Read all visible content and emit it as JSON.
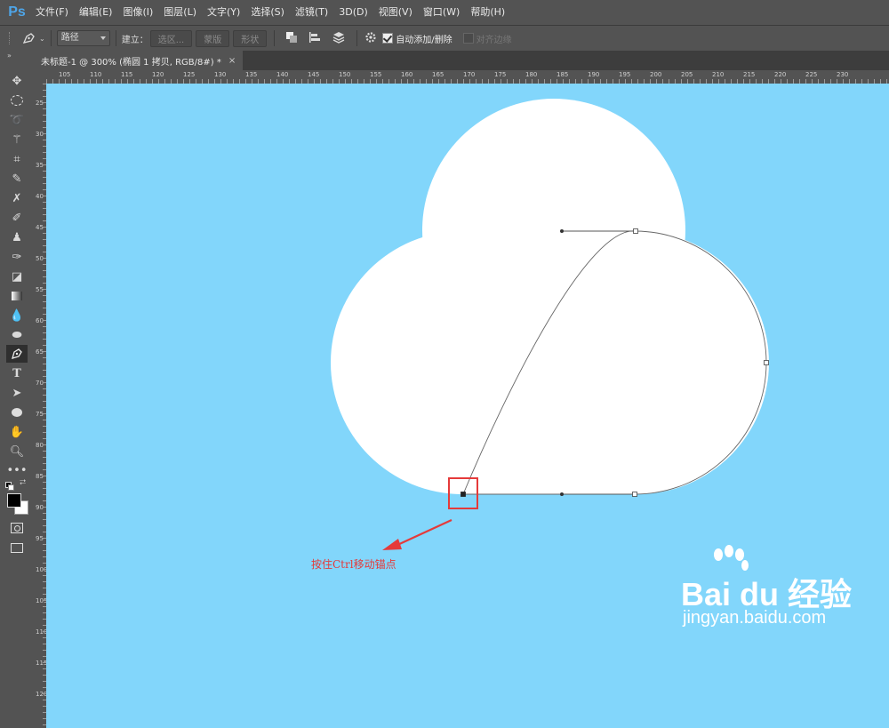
{
  "app": {
    "logo": "Ps",
    "menu": [
      "文件(F)",
      "编辑(E)",
      "图像(I)",
      "图层(L)",
      "文字(Y)",
      "选择(S)",
      "滤镜(T)",
      "3D(D)",
      "视图(V)",
      "窗口(W)",
      "帮助(H)"
    ]
  },
  "options": {
    "tool_icon": "pen-icon",
    "mode_select": "路径",
    "make_label": "建立：",
    "selection_btn": "选区...",
    "mask_btn": "蒙版",
    "shape_btn": "形状",
    "auto_add_delete_label": "自动添加/删除",
    "auto_add_delete_checked": true,
    "align_edges_label": "对齐边缘",
    "align_edges_checked": false
  },
  "document": {
    "tab_title": "未标题-1 @ 300% (椭圆 1 拷贝, RGB/8#) *",
    "tab_close": "×"
  },
  "rulers": {
    "top_labels": [
      "105",
      "110",
      "115",
      "120",
      "125",
      "130",
      "135",
      "140",
      "145",
      "150",
      "155",
      "160",
      "165",
      "170",
      "175",
      "180",
      "185",
      "190",
      "195",
      "200",
      "205",
      "210",
      "215",
      "220",
      "225",
      "230"
    ],
    "left_labels": [
      "25",
      "30",
      "35",
      "40",
      "45",
      "50",
      "55",
      "60",
      "65",
      "70",
      "75",
      "80",
      "85",
      "90",
      "95",
      "100",
      "105",
      "110",
      "115",
      "120"
    ]
  },
  "canvas": {
    "background": "#82d6fb",
    "shape_color": "#ffffff",
    "highlight_color": "#e53a3a",
    "tip_text": "按住Ctrl移动锚点"
  },
  "watermark": {
    "main": "Bai du 经验",
    "url": "jingyan.baidu.com"
  }
}
